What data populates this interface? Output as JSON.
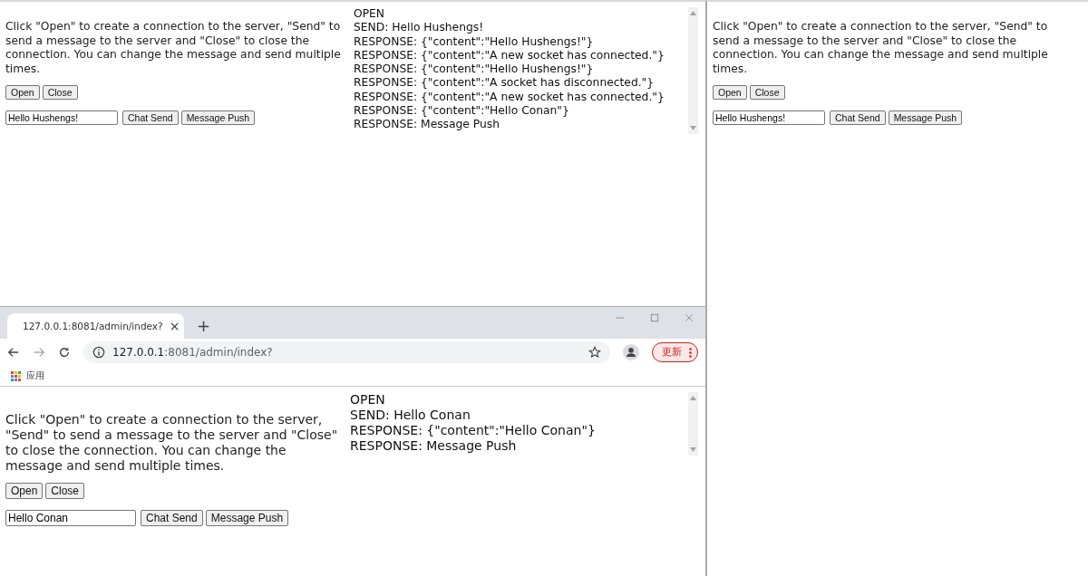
{
  "top_page": {
    "instructions": "Click \"Open\" to create a connection to the server, \"Send\" to send a message to the server and \"Close\" to close the connection. You can change the message and send multiple times.",
    "connection_buttons": [
      "Open",
      "Close"
    ],
    "message_field": {
      "value": "Hello Hushengs!"
    },
    "send_buttons": [
      "Chat Send",
      "Message Push"
    ],
    "log": [
      "OPEN",
      "SEND: Hello Hushengs!",
      "RESPONSE: {\"content\":\"Hello Hushengs!\"}",
      "RESPONSE: {\"content\":\"A new socket has connected.\"}",
      "RESPONSE: {\"content\":\"Hello Hushengs!\"}",
      "RESPONSE: {\"content\":\"A socket has disconnected.\"}",
      "RESPONSE: {\"content\":\"A new socket has connected.\"}",
      "RESPONSE: {\"content\":\"Hello Conan\"}",
      "RESPONSE: Message Push"
    ]
  },
  "right_page": {
    "instructions": "Click \"Open\" to create a connection to the server, \"Send\" to send a message to the server and \"Close\" to close the connection. You can change the message and send multiple times.",
    "connection_buttons": [
      "Open",
      "Close"
    ],
    "message_field": {
      "value": "Hello Hushengs!"
    },
    "send_buttons": [
      "Chat Send",
      "Message Push"
    ]
  },
  "browser": {
    "tab": {
      "title": "127.0.0.1:8081/admin/index?",
      "close": "×"
    },
    "new_tab": "+",
    "address": {
      "host": "127.0.0.1",
      "rest": ":8081/admin/index?"
    },
    "update_button": "更新",
    "bookmarks": [
      {
        "label": "应用"
      }
    ],
    "page": {
      "instructions": "Click \"Open\" to create a connection to the server, \"Send\" to send a message to the server and \"Close\" to close the connection. You can change the message and send multiple times.",
      "connection_buttons": [
        "Open",
        "Close"
      ],
      "message_field": {
        "value": "Hello Conan"
      },
      "send_buttons": [
        "Chat Send",
        "Message Push"
      ],
      "log": [
        "OPEN",
        "SEND: Hello Conan",
        "RESPONSE: {\"content\":\"Hello Conan\"}",
        "RESPONSE: Message Push"
      ]
    }
  }
}
